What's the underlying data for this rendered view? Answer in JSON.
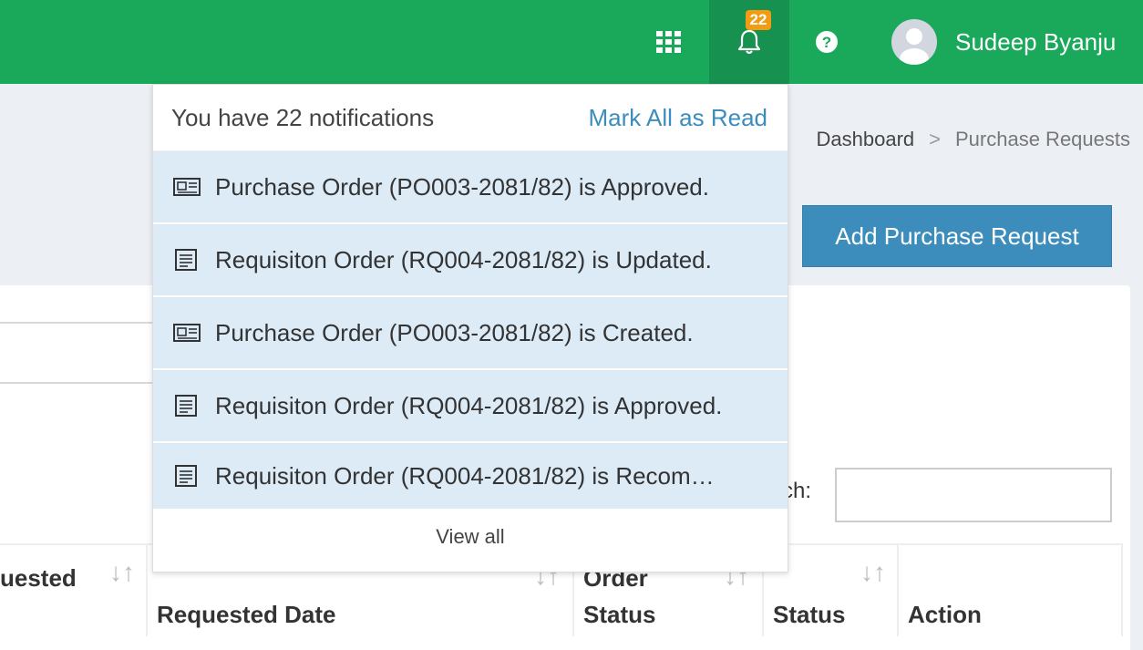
{
  "navbar": {
    "notification_count": "22",
    "user_name": "Sudeep Byanju",
    "icons": {
      "apps": "grid-icon",
      "notifications": "bell-icon",
      "help": "question-circle-icon",
      "avatar": "user-avatar-icon"
    }
  },
  "breadcrumb": {
    "home": "Dashboard",
    "separator": ">",
    "current": "Purchase Requests"
  },
  "actions": {
    "add_label": "Add Purchase Request"
  },
  "search": {
    "label": "ch:"
  },
  "table": {
    "columns": [
      {
        "label": "uested",
        "sort_icon": "sort-icon"
      },
      {
        "label": "Requested Date",
        "sort_icon": "sort-icon"
      },
      {
        "label": "Status",
        "top_label": "Order",
        "sort_icon": "sort-icon"
      },
      {
        "label": "Status",
        "sort_icon": "sort-icon"
      },
      {
        "label": "Action"
      }
    ]
  },
  "notifications": {
    "header": "You have 22 notifications",
    "mark_all": "Mark All as Read",
    "items": [
      {
        "icon": "newspaper-icon",
        "text": "Purchase Order (PO003-2081/82) is Approved."
      },
      {
        "icon": "list-icon",
        "text": "Requisiton Order (RQ004-2081/82) is Updated."
      },
      {
        "icon": "newspaper-icon",
        "text": "Purchase Order (PO003-2081/82) is Created."
      },
      {
        "icon": "list-icon",
        "text": "Requisiton Order (RQ004-2081/82) is Approved."
      },
      {
        "icon": "list-icon",
        "text": "Requisiton Order (RQ004-2081/82) is Recom…"
      }
    ],
    "view_all": "View all"
  },
  "colors": {
    "navbar": "#1aa85b",
    "bell_active": "#17914f",
    "badge": "#f39c12",
    "primary": "#3c8dbc",
    "notif_bg": "#dcebf6"
  }
}
